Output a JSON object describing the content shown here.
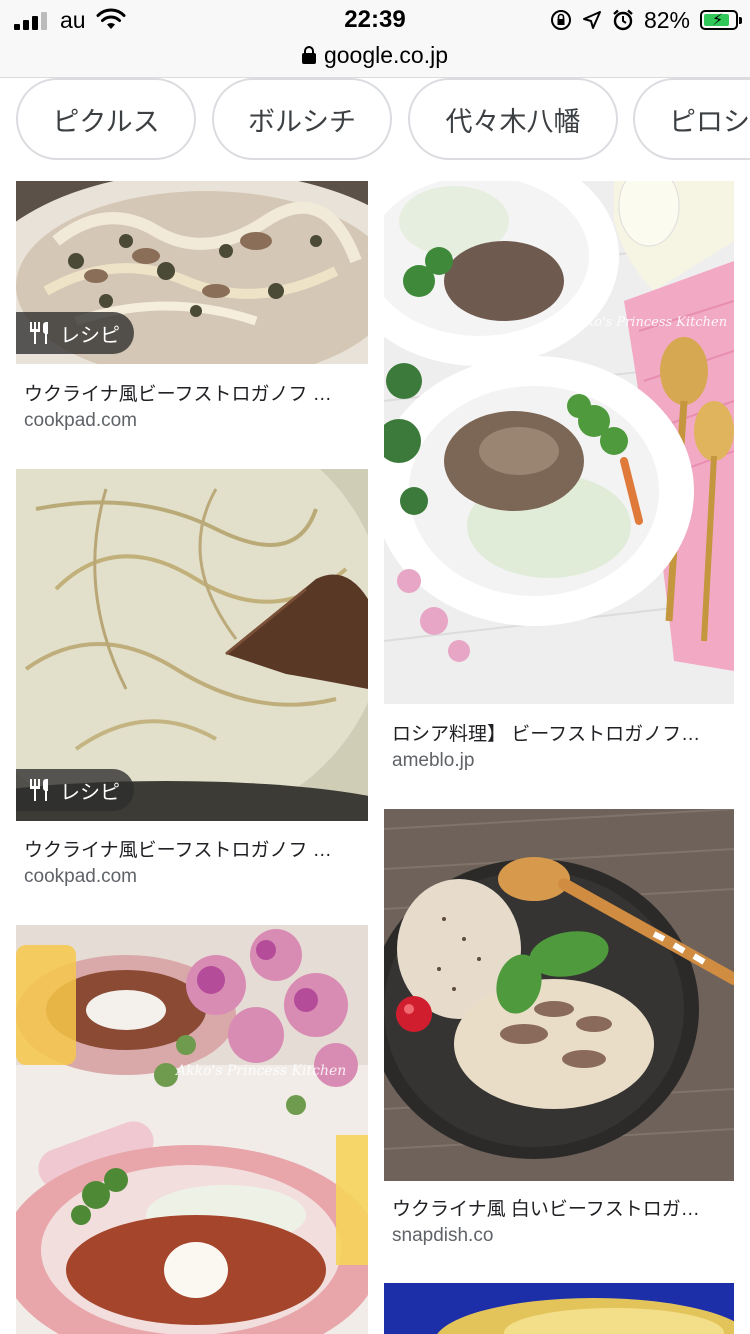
{
  "status_bar": {
    "carrier": "au",
    "time": "22:39",
    "battery_percent": "82%",
    "battery_level": 0.82,
    "icons": [
      "cellular-signal-icon",
      "wifi-icon",
      "orientation-lock-icon",
      "location-arrow-icon",
      "alarm-clock-icon",
      "battery-charging-icon"
    ]
  },
  "browser": {
    "url": "google.co.jp",
    "secure_icon": "lock-icon"
  },
  "chips": [
    {
      "label": "ピクルス"
    },
    {
      "label": "ボルシチ"
    },
    {
      "label": "代々木八幡"
    },
    {
      "label": "ピロシ"
    }
  ],
  "results": {
    "left": [
      {
        "badge": "レシピ",
        "title": "ウクライナ風ビーフストロガノフ …",
        "domain": "cookpad.com"
      },
      {
        "badge": "レシピ",
        "title": "ウクライナ風ビーフストロガノフ …",
        "domain": "cookpad.com"
      },
      {
        "badge": "",
        "title": "",
        "domain": "",
        "watermark": "Akko's Princess Kitchen"
      }
    ],
    "right": [
      {
        "badge": "",
        "title": "ロシア料理】 ビーフストロガノフ…",
        "domain": "ameblo.jp",
        "watermark": "Akko's Princess Kitchen"
      },
      {
        "badge": "",
        "title": "ウクライナ風 白いビーフストロガ…",
        "domain": "snapdish.co"
      },
      {
        "badge": "",
        "title": "",
        "domain": ""
      }
    ]
  },
  "colors": {
    "chip_border": "#dadce0",
    "badge_bg": "#2d2d2d",
    "domain_text": "#5f6368",
    "battery_fill": "#32c759"
  }
}
